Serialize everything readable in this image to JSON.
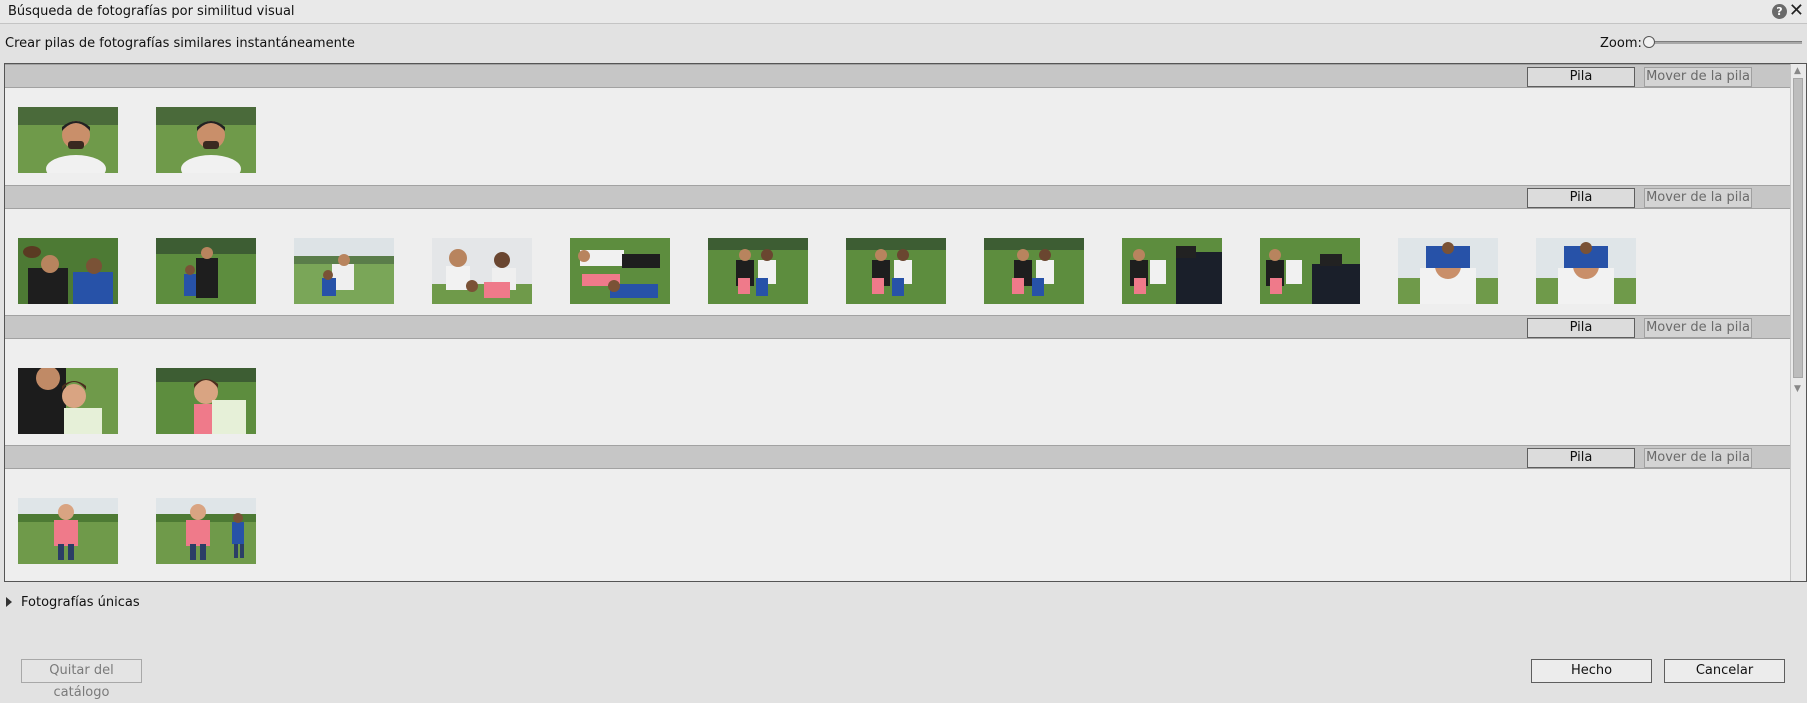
{
  "window": {
    "title": "Búsqueda de fotografías por similitud visual",
    "help_icon": "help-icon",
    "close_icon": "close-icon"
  },
  "toolbar": {
    "subtitle": "Crear pilas de fotografías similares instantáneamente",
    "zoom_label": "Zoom:",
    "zoom_level": 0
  },
  "stacks": [
    {
      "pila_label": "Pila",
      "mover_label": "Mover de la pila",
      "photo_count": 2
    },
    {
      "pila_label": "Pila",
      "mover_label": "Mover de la pila",
      "photo_count": 12
    },
    {
      "pila_label": "Pila",
      "mover_label": "Mover de la pila",
      "photo_count": 2
    },
    {
      "pila_label": "Pila",
      "mover_label": "Mover de la pila",
      "photo_count": 2
    }
  ],
  "unique_section": {
    "label": "Fotografías únicas",
    "expanded": false
  },
  "footer": {
    "remove_label": "Quitar del catálogo",
    "done_label": "Hecho",
    "cancel_label": "Cancelar"
  },
  "colors": {
    "grass": "#5b8c3d",
    "header_band": "#c6c6c6",
    "panel_bg": "#eeeeee"
  }
}
